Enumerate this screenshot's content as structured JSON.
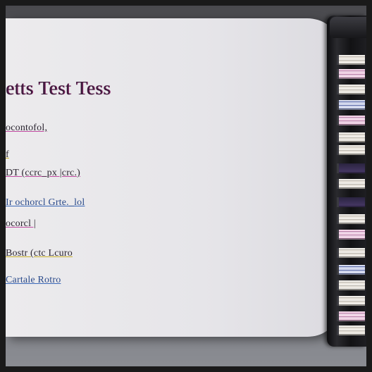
{
  "document": {
    "title": "etts Test Tess",
    "lines": [
      "ocontofol,",
      "f",
      "DT (ccrc_px |crc.)",
      "Ir ochorcl Grte._lol",
      "ocorcl |",
      "Bostr (ctc Lcuro",
      "Cartale Rotro"
    ]
  },
  "colors": {
    "title": "#3a1a3a",
    "accent_pink": "#c04aa0",
    "accent_yellow": "#c9b02a",
    "accent_blue": "#3a68b8"
  }
}
